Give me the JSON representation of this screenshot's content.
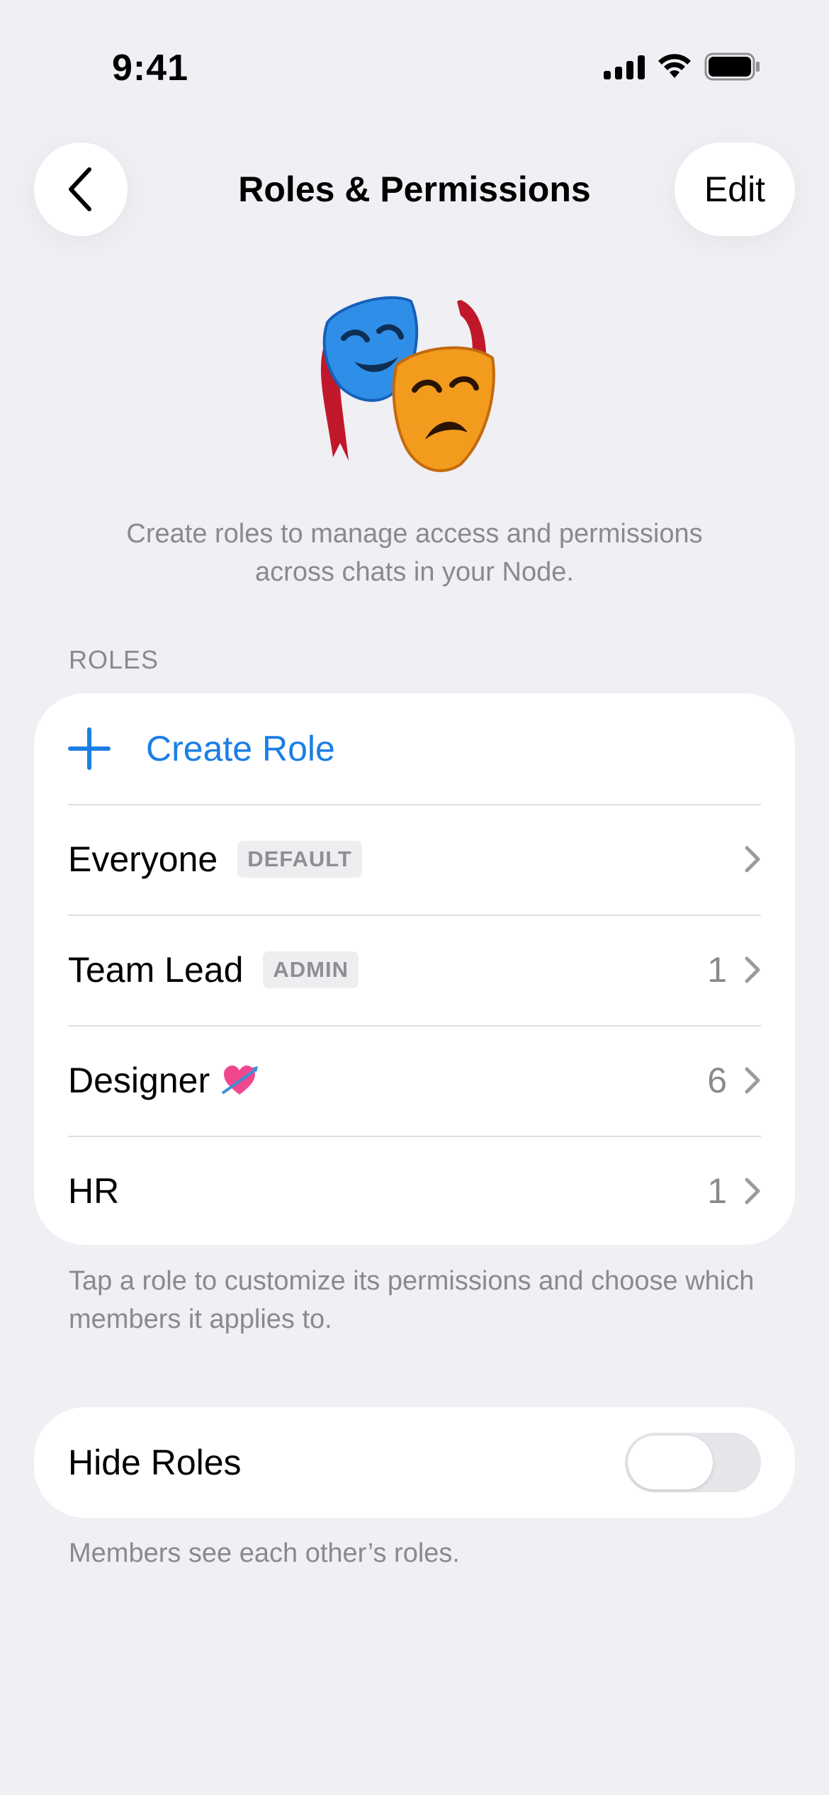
{
  "status_bar": {
    "time": "9:41"
  },
  "nav": {
    "title": "Roles & Permissions",
    "edit_label": "Edit",
    "back_icon": "chevron-left-icon"
  },
  "hero": {
    "icon": "theater-masks-icon",
    "description": "Create roles to manage access and permissions across chats in your Node."
  },
  "roles_section": {
    "header": "ROLES",
    "create_label": "Create Role",
    "roles": [
      {
        "name": "Everyone",
        "badge": "DEFAULT",
        "count": ""
      },
      {
        "name": "Team Lead",
        "badge": "ADMIN",
        "count": "1"
      },
      {
        "name": "Designer",
        "badge": "",
        "count": "6",
        "emoji": "heart-with-arrow-icon"
      },
      {
        "name": "HR",
        "badge": "",
        "count": "1"
      }
    ],
    "footer": "Tap a role to customize its permissions and choose which members it applies to."
  },
  "hide_roles": {
    "label": "Hide Roles",
    "enabled": false,
    "footer": "Members see each other’s roles."
  },
  "colors": {
    "accent": "#1a7ee6",
    "background": "#efeff4",
    "secondary_text": "#8a8a8e"
  }
}
